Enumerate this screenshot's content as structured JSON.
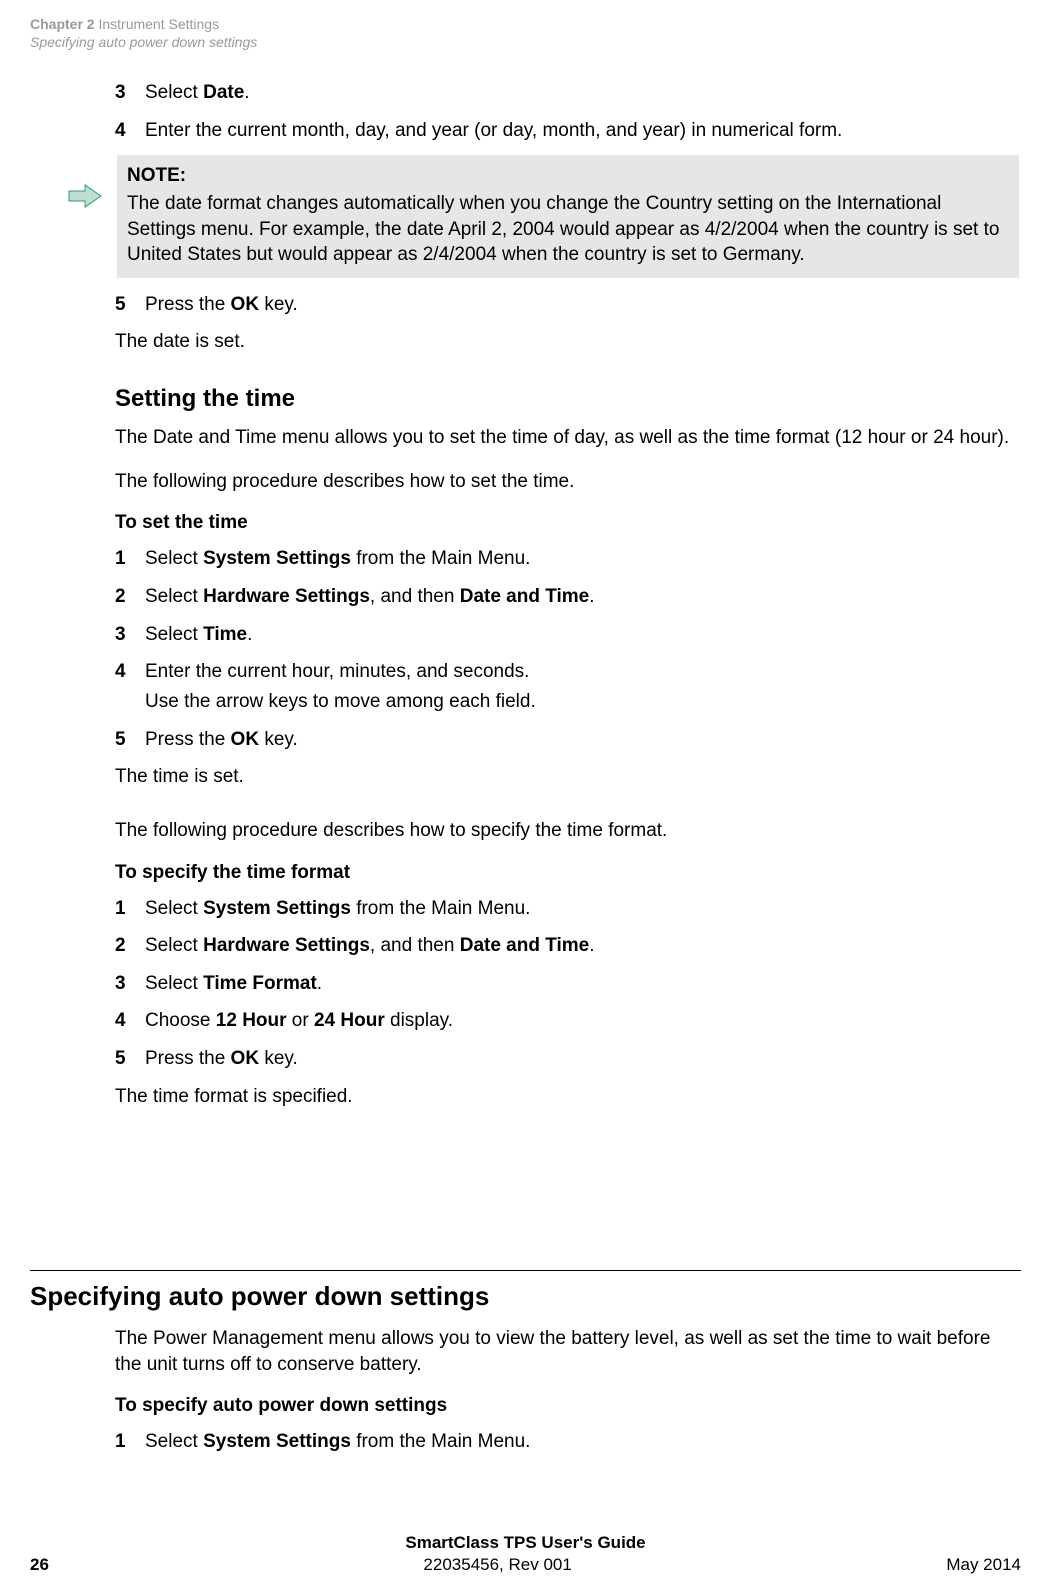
{
  "header": {
    "chapter_bold": "Chapter 2",
    "chapter_light": "  Instrument Settings",
    "line2": "Specifying auto power down settings"
  },
  "topsteps": {
    "s3_num": "3",
    "s3_pre": "Select ",
    "s3_b1": "Date",
    "s3_post": ".",
    "s4_num": "4",
    "s4_txt": "Enter the current month, day, and year (or day, month, and year) in numerical form.",
    "s5_num": "5",
    "s5_pre": "Press the ",
    "s5_b1": "OK",
    "s5_post": " key."
  },
  "note": {
    "title": "NOTE:",
    "body": "The date format changes automatically when you change the Country setting on the International Settings menu. For example, the date April 2, 2004 would appear as 4/2/2004 when the country is set to United States but would appear as 2/4/2004 when the country is set to Germany."
  },
  "top_result": "The date is set.",
  "sec1": {
    "heading": "Setting the time",
    "intro": "The Date and Time menu allows you to set the time of day, as well as the time format (12 hour or 24 hour).",
    "lead": "The following procedure describes how to set the time.",
    "sub": "To set the time",
    "s1_num": "1",
    "s1_pre": "Select ",
    "s1_b1": "System Settings",
    "s1_post": " from the Main Menu.",
    "s2_num": "2",
    "s2_pre": "Select ",
    "s2_b1": "Hardware Settings",
    "s2_mid": ", and then ",
    "s2_b2": "Date and Time",
    "s2_post": ".",
    "s3_num": "3",
    "s3_pre": "Select ",
    "s3_b1": "Time",
    "s3_post": ".",
    "s4_num": "4",
    "s4_txt": "Enter the current hour, minutes, and seconds.",
    "s4_sub": "Use the arrow keys to move among each field.",
    "s5_num": "5",
    "s5_pre": "Press the ",
    "s5_b1": "OK",
    "s5_post": " key.",
    "result": "The time is set."
  },
  "sec2": {
    "lead": "The following procedure describes how to specify the time format.",
    "sub": "To specify the time format",
    "s1_num": "1",
    "s1_pre": "Select ",
    "s1_b1": "System Settings",
    "s1_post": " from the Main Menu.",
    "s2_num": "2",
    "s2_pre": "Select ",
    "s2_b1": "Hardware Settings",
    "s2_mid": ", and then ",
    "s2_b2": "Date and Time",
    "s2_post": ".",
    "s3_num": "3",
    "s3_pre": "Select ",
    "s3_b1": "Time Format",
    "s3_post": ".",
    "s4_num": "4",
    "s4_pre": "Choose ",
    "s4_b1": "12 Hour",
    "s4_mid": " or ",
    "s4_b2": "24 Hour",
    "s4_post": " display.",
    "s5_num": "5",
    "s5_pre": "Press the ",
    "s5_b1": "OK",
    "s5_post": " key.",
    "result": "The time format is specified."
  },
  "big": {
    "heading": "Specifying auto power down settings",
    "intro": "The Power Management menu allows you to view the battery level, as well as set the time to wait before the unit turns off to conserve battery.",
    "sub": "To specify auto power down settings",
    "s1_num": "1",
    "s1_pre": "Select ",
    "s1_b1": "System Settings",
    "s1_post": " from the Main Menu."
  },
  "footer": {
    "center": "SmartClass TPS User's Guide",
    "page": "26",
    "docnum": "22035456, Rev 001",
    "date": "May 2014"
  }
}
